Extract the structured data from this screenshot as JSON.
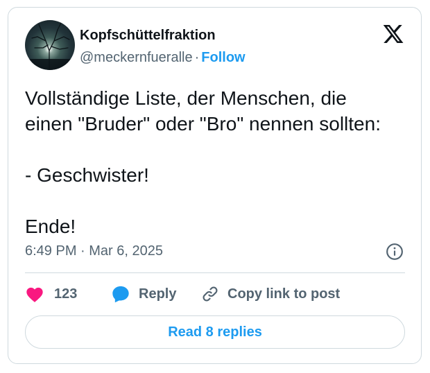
{
  "author": {
    "display_name": "Kopfschüttelfraktion",
    "handle": "@meckernfueralle",
    "separator": "·",
    "follow_label": "Follow"
  },
  "tweet": {
    "text": "Vollständige Liste, der Menschen, die\neinen \"Bruder\" oder \"Bro\" nennen sollten:\n\n- Geschwister!\n\nEnde!",
    "timestamp": "6:49 PM · Mar 6, 2025"
  },
  "actions": {
    "like_count": "123",
    "reply_label": "Reply",
    "copy_label": "Copy link to post"
  },
  "footer": {
    "read_replies_label": "Read 8 replies"
  },
  "colors": {
    "accent": "#1d9bf0",
    "like": "#f91880",
    "secondary_text": "#536471",
    "border": "#cfd9de"
  },
  "icons": [
    "x-logo-icon",
    "info-icon",
    "heart-icon",
    "reply-bubble-icon",
    "link-icon"
  ]
}
